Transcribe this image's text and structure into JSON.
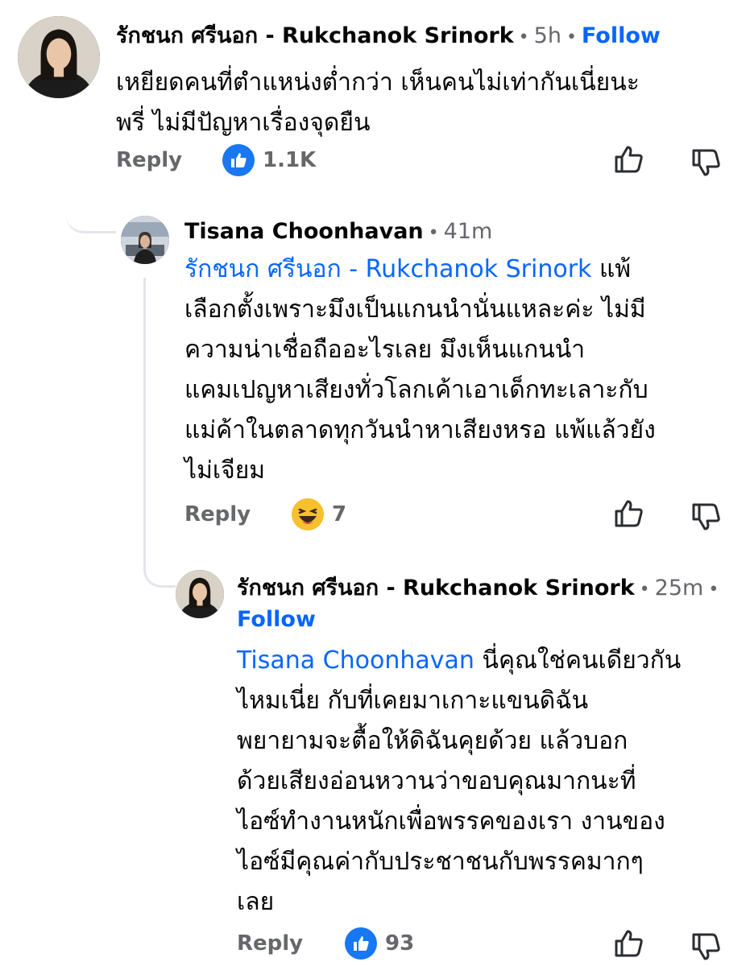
{
  "comments": [
    {
      "author": "รักชนก ศรีนอก - Rukchanok Srinork",
      "time": "5h",
      "follow": "Follow",
      "text_lines": [
        "เหยียดคนที่ตำแหน่งต่ำกว่า เห็นคนไม่เท่ากันเนี่ยนะ",
        "พรี่ ไม่มีปัญหาเรื่องจุดยืน"
      ],
      "reply_label": "Reply",
      "reaction_count": "1.1K",
      "reaction_type": "like"
    },
    {
      "author": "Tisana Choonhavan",
      "time": "41m",
      "mention": "รักชนก ศรีนอก - Rukchanok Srinork",
      "text_first_rest": " แพ้",
      "text_lines": [
        "เลือกตั้งเพราะมึงเป็นแกนนำนั่นแหละค่ะ ไม่มี",
        "ความน่าเชื่อถืออะไรเลย มึงเห็นแกนนำ",
        "แคมเปญหาเสียงทั่วโลกเค้าเอาเด็กทะเลาะกับ",
        "แม่ค้าในตลาดทุกวันนำหาเสียงหรอ แพ้แล้วยัง",
        "ไม่เจียม"
      ],
      "reply_label": "Reply",
      "reaction_count": "7",
      "reaction_type": "haha"
    },
    {
      "author": "รักชนก ศรีนอก - Rukchanok Srinork",
      "time": "25m",
      "follow": "Follow",
      "mention": "Tisana Choonhavan",
      "text_first_rest": " นี่คุณใช่คนเดียวกัน",
      "text_lines": [
        "ไหมเนี่ย กับที่เคยมาเกาะแขนดิฉัน",
        "พยายามจะตื้อให้ดิฉันคุยด้วย แล้วบอก",
        "ด้วยเสียงอ่อนหวานว่าขอบคุณมากนะที่",
        "ไอซ์ทำงานหนักเพื่อพรรคของเรา งานของ",
        "ไอซ์มีคุณค่ากับประชาชนกับพรรคมากๆ",
        "เลย"
      ],
      "reply_label": "Reply",
      "reaction_count": "93",
      "reaction_type": "like"
    }
  ],
  "colors": {
    "link": "#0866ff",
    "meta": "#65676b",
    "text": "#050505",
    "thread": "#e4e6eb"
  },
  "icons": {
    "like_button": "thumbs-up-outline-icon",
    "dislike_button": "thumbs-down-outline-icon",
    "like_reaction": "like-reaction-icon",
    "haha_reaction": "haha-reaction-icon"
  }
}
